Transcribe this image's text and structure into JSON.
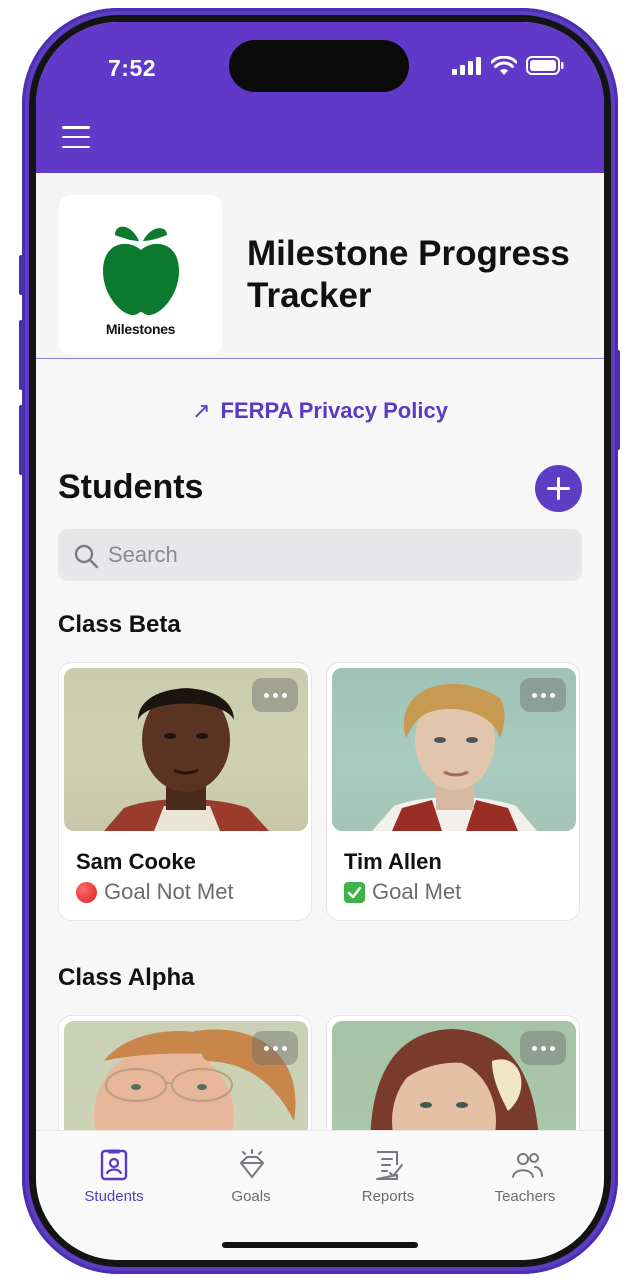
{
  "status_bar": {
    "time": "7:52"
  },
  "brand": {
    "logo_caption": "Milestones",
    "title": "Milestone Progress Tracker"
  },
  "policy_link": {
    "label": "FERPA Privacy Policy"
  },
  "students": {
    "title": "Students",
    "search_placeholder": "Search"
  },
  "classes": [
    {
      "name": "Class Beta",
      "students": [
        {
          "name": "Sam Cooke",
          "status": "Goal Not Met",
          "status_icon": "red-circle-icon"
        },
        {
          "name": "Tim Allen",
          "status": "Goal Met",
          "status_icon": "green-check-icon"
        }
      ]
    },
    {
      "name": "Class Alpha",
      "students": []
    }
  ],
  "tabs": [
    {
      "label": "Students",
      "icon": "student-badge-icon",
      "active": true
    },
    {
      "label": "Goals",
      "icon": "diamond-icon",
      "active": false
    },
    {
      "label": "Reports",
      "icon": "report-icon",
      "active": false
    },
    {
      "label": "Teachers",
      "icon": "people-icon",
      "active": false
    }
  ],
  "colors": {
    "accent": "#6139c9",
    "logo_green": "#0b7a2e"
  }
}
